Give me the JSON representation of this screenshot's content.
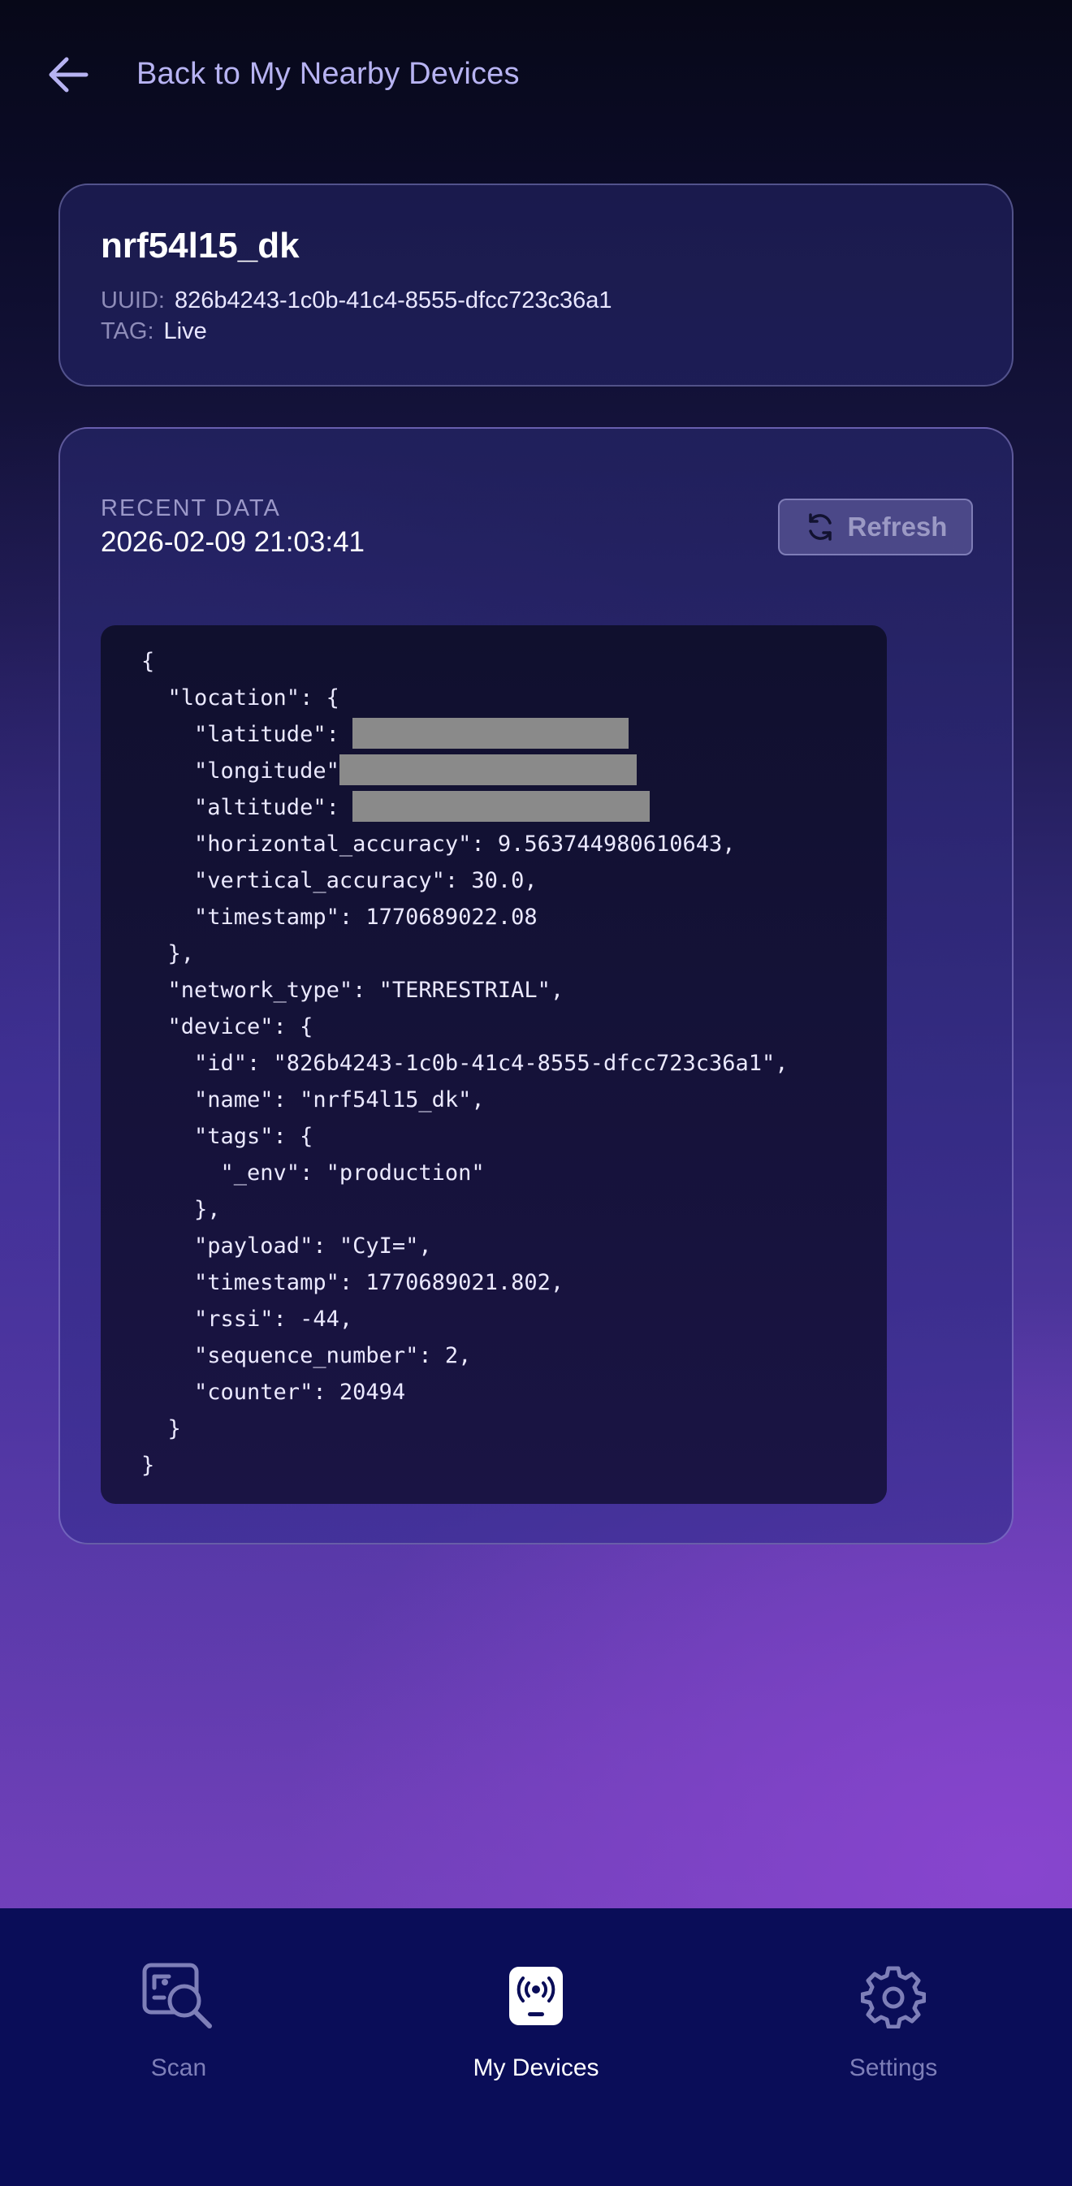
{
  "header": {
    "back_label": "Back to My Nearby Devices"
  },
  "device": {
    "name": "nrf54l15_dk",
    "uuid_label": "UUID:",
    "uuid": "826b4243-1c0b-41c4-8555-dfcc723c36a1",
    "tag_label": "TAG:",
    "tag": "Live"
  },
  "recent": {
    "label": "RECENT DATA",
    "timestamp": "2026-02-09 21:03:41",
    "refresh_label": "Refresh"
  },
  "json_lines": [
    "{",
    "  \"location\": {",
    "    \"latitude\": ",
    "    \"longitude\"",
    "    \"altitude\": ",
    "    \"horizontal_accuracy\": 9.563744980610643,",
    "    \"vertical_accuracy\": 30.0,",
    "    \"timestamp\": 1770689022.08",
    "  },",
    "  \"network_type\": \"TERRESTRIAL\",",
    "  \"device\": {",
    "    \"id\": \"826b4243-1c0b-41c4-8555-dfcc723c36a1\",",
    "    \"name\": \"nrf54l15_dk\",",
    "    \"tags\": {",
    "      \"_env\": \"production\"",
    "    },",
    "    \"payload\": \"CyI=\",",
    "    \"timestamp\": 1770689021.802,",
    "    \"rssi\": -44,",
    "    \"sequence_number\": 2,",
    "    \"counter\": 20494",
    "  }",
    "}"
  ],
  "nav": {
    "scan": "Scan",
    "my_devices": "My Devices",
    "settings": "Settings"
  },
  "icons": {
    "back": "arrow-left-icon",
    "refresh": "refresh-icon",
    "scan": "scan-search-icon",
    "my_devices": "broadcast-device-icon",
    "settings": "gear-icon"
  },
  "colors": {
    "accent": "#b7b3f2",
    "nav_bg": "#0a0d58",
    "redaction": "#8a8a8a"
  }
}
